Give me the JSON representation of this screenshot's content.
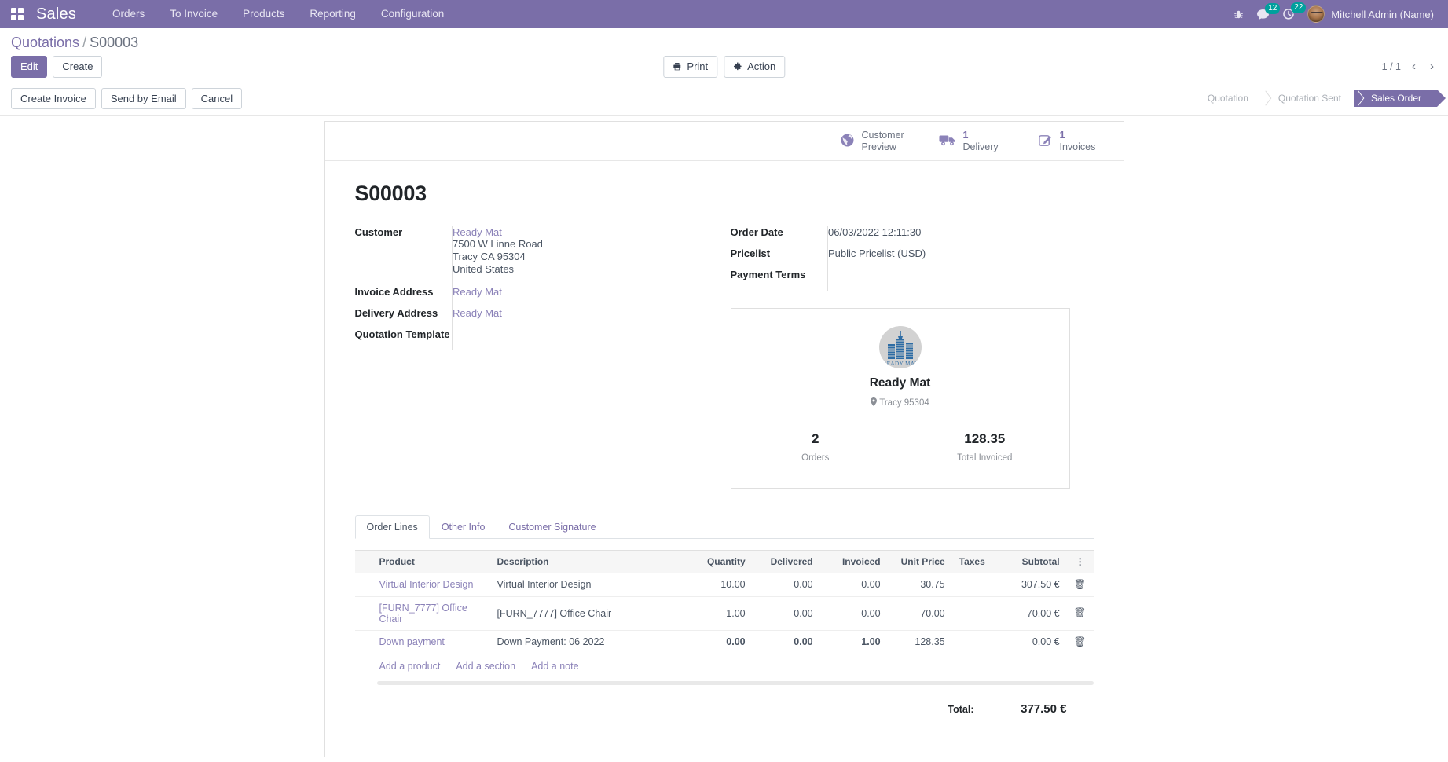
{
  "navbar": {
    "apps_icon": "apps-grid-icon",
    "brand": "Sales",
    "menus": [
      {
        "label": "Orders"
      },
      {
        "label": "To Invoice"
      },
      {
        "label": "Products"
      },
      {
        "label": "Reporting"
      },
      {
        "label": "Configuration"
      }
    ],
    "bug_icon": "bug-icon",
    "messages": {
      "icon": "messages-icon",
      "count": "12"
    },
    "activities": {
      "icon": "activities-clock-icon",
      "count": "22"
    },
    "user": {
      "avatar": "user-avatar",
      "name": "Mitchell Admin (Name)"
    }
  },
  "control_panel": {
    "breadcrumb": {
      "root": "Quotations",
      "separator": "/",
      "current": "S00003"
    },
    "edit_label": "Edit",
    "create_label": "Create",
    "print_label": "Print",
    "print_icon": "printer-icon",
    "action_label": "Action",
    "action_icon": "gear-icon",
    "pager": "1 / 1",
    "prev_icon": "chevron-left-icon",
    "next_icon": "chevron-right-icon",
    "workflow_buttons": [
      {
        "label": "Create Invoice"
      },
      {
        "label": "Send by Email"
      },
      {
        "label": "Cancel"
      }
    ],
    "statusbar": [
      {
        "label": "Quotation",
        "active": false
      },
      {
        "label": "Quotation Sent",
        "active": false
      },
      {
        "label": "Sales Order",
        "active": true
      }
    ]
  },
  "smart_buttons": [
    {
      "icon": "globe-icon",
      "count": "",
      "line1": "Customer",
      "line2": "Preview"
    },
    {
      "icon": "truck-icon",
      "count": "1",
      "line1": "Delivery",
      "line2": ""
    },
    {
      "icon": "pencil-square-icon",
      "count": "1",
      "line1": "Invoices",
      "line2": ""
    }
  ],
  "record": {
    "title": "S00003",
    "left_fields": [
      {
        "label": "Customer",
        "value": "Ready Mat",
        "is_link": true,
        "address": [
          "7500 W Linne Road",
          "Tracy CA 95304",
          "United States"
        ]
      },
      {
        "label": "Invoice Address",
        "value": "Ready Mat",
        "is_link": true
      },
      {
        "label": "Delivery Address",
        "value": "Ready Mat",
        "is_link": true
      },
      {
        "label": "Quotation Template",
        "value": "",
        "is_link": false
      }
    ],
    "right_fields": [
      {
        "label": "Order Date",
        "value": "06/03/2022 12:11:30"
      },
      {
        "label": "Pricelist",
        "value": "Public Pricelist (USD)"
      },
      {
        "label": "Payment Terms",
        "value": ""
      }
    ]
  },
  "partner_card": {
    "logo_icon": "ready-mat-skyline-logo",
    "logo_caption": "READY MAT",
    "name": "Ready Mat",
    "location_icon": "map-pin-icon",
    "location": "Tracy  95304",
    "stats": [
      {
        "value": "2",
        "label": "Orders"
      },
      {
        "value": "128.35",
        "label": "Total Invoiced"
      }
    ]
  },
  "notebook": {
    "tabs": [
      {
        "label": "Order Lines",
        "active": true
      },
      {
        "label": "Other Info",
        "active": false
      },
      {
        "label": "Customer Signature",
        "active": false
      }
    ]
  },
  "order_lines": {
    "columns": [
      "Product",
      "Description",
      "Quantity",
      "Delivered",
      "Invoiced",
      "Unit Price",
      "Taxes",
      "Subtotal"
    ],
    "options_icon": "options-dots-icon",
    "delete_icon": "trash-icon",
    "rows": [
      {
        "product": "Virtual Interior Design",
        "description": "Virtual Interior Design",
        "quantity": "10.00",
        "delivered": "0.00",
        "invoiced": "0.00",
        "unit_price": "30.75",
        "taxes": "",
        "subtotal": "307.50 €",
        "highlight": false
      },
      {
        "product": "[FURN_7777] Office Chair",
        "description": "[FURN_7777] Office Chair",
        "quantity": "1.00",
        "delivered": "0.00",
        "invoiced": "0.00",
        "unit_price": "70.00",
        "taxes": "",
        "subtotal": "70.00 €",
        "highlight": false
      },
      {
        "product": "Down payment",
        "description": "Down Payment: 06 2022",
        "quantity": "0.00",
        "delivered": "0.00",
        "invoiced": "1.00",
        "unit_price": "128.35",
        "taxes": "",
        "subtotal": "0.00 €",
        "highlight": true
      }
    ],
    "add_links": [
      {
        "label": "Add a product"
      },
      {
        "label": "Add a section"
      },
      {
        "label": "Add a note"
      }
    ]
  },
  "totals": {
    "label": "Total:",
    "value": "377.50 €"
  },
  "colors": {
    "brand_purple": "#7a6ea8",
    "link_purple": "#8b82b8",
    "badge_teal": "#00a09d",
    "highlight_blue": "#0b79bf"
  }
}
